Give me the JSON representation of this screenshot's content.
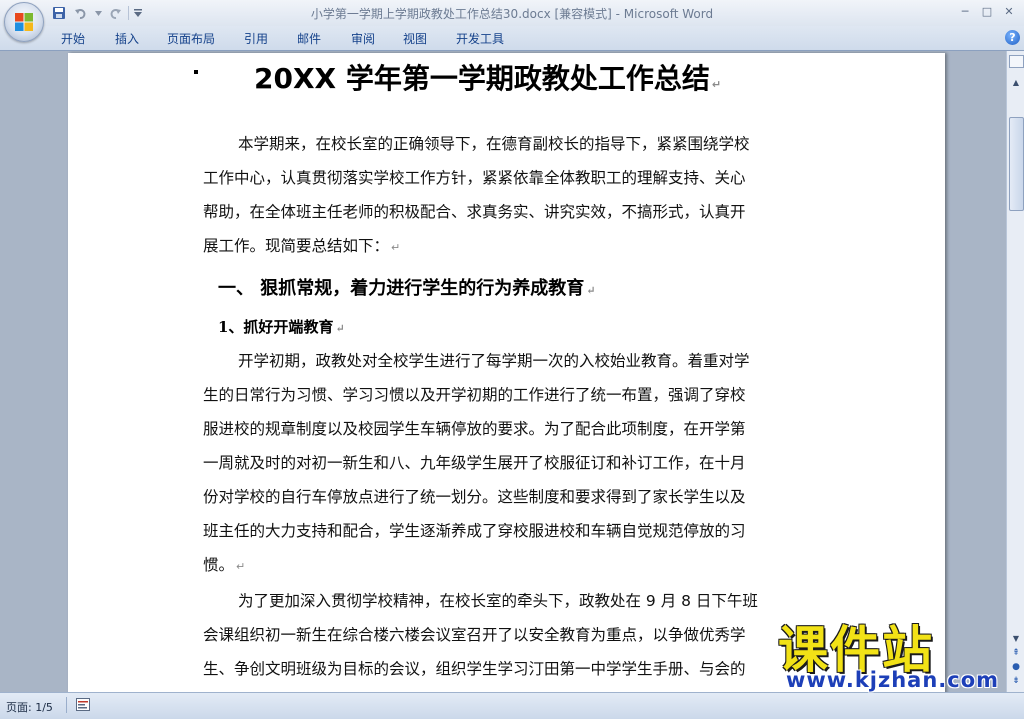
{
  "window": {
    "title": "小学第一学期上学期政教处工作总结30.docx [兼容模式] - Microsoft Word",
    "minimize": "─",
    "maximize": "□",
    "close": "✕"
  },
  "ribbon": {
    "tabs": [
      "开始",
      "插入",
      "页面布局",
      "引用",
      "邮件",
      "审阅",
      "视图",
      "开发工具"
    ],
    "help_label": "?"
  },
  "document": {
    "title": "20XX 学年第一学期政教处工作总结",
    "intro_lines": [
      "本学期来，在校长室的正确领导下，在德育副校长的指导下，紧紧围绕学校",
      "工作中心，认真贯彻落实学校工作方针，紧紧依靠全体教职工的理解支持、关心",
      "帮助，在全体班主任老师的积极配合、求真务实、讲究实效，不搞形式，认真开",
      "展工作。现简要总结如下："
    ],
    "section_heading": "一、 狠抓常规，着力进行学生的行为养成教育",
    "subsection_heading": "1、抓好开端教育",
    "body_lines": [
      "开学初期，政教处对全校学生进行了每学期一次的入校始业教育。着重对学",
      "生的日常行为习惯、学习习惯以及开学初期的工作进行了统一布置，强调了穿校",
      "服进校的规章制度以及校园学生车辆停放的要求。为了配合此项制度，在开学第",
      "一周就及时的对初一新生和八、九年级学生展开了校服征订和补订工作，在十月",
      "份对学校的自行车停放点进行了统一划分。这些制度和要求得到了家长学生以及",
      "班主任的大力支持和配合，学生逐渐养成了穿校服进校和车辆自觉规范停放的习",
      "惯。"
    ],
    "body2_lines": [
      "为了更加深入贯彻学校精神，在校长室的牵头下，政教处在 9 月 8 日下午班",
      "会课组织初一新生在综合楼六楼会议室召开了以安全教育为重点，以争做优秀学",
      "生、争创文明班级为目标的会议，组织学生学习汀田第一中学学生手册、与会的"
    ],
    "paragraph_mark": "↵"
  },
  "status": {
    "page": "页面: 1/5"
  },
  "watermark": {
    "text": "课件站",
    "url": "www.kjzhan.com"
  }
}
